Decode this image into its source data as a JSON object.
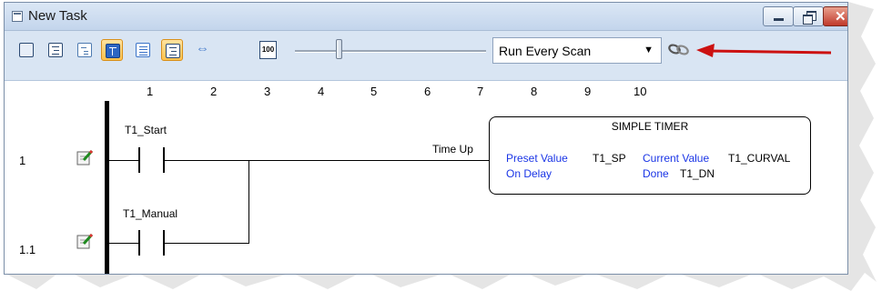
{
  "window": {
    "title": "New Task"
  },
  "toolbar": {
    "buttons": [
      {
        "name": "view-ladder-button",
        "active": false
      },
      {
        "name": "view-list-button",
        "active": false
      },
      {
        "name": "view-tree-button",
        "active": false
      },
      {
        "name": "view-text-button",
        "active": true
      },
      {
        "name": "view-detail-button",
        "active": false
      },
      {
        "name": "view-structure-button",
        "active": true
      }
    ],
    "zoom_label": "100",
    "run_mode": "Run Every Scan"
  },
  "ruler": {
    "columns": [
      "1",
      "2",
      "3",
      "4",
      "5",
      "6",
      "7",
      "8",
      "9",
      "10"
    ]
  },
  "rungs": [
    {
      "number": "1",
      "contact_tag": "T1_Start"
    },
    {
      "number": "1.1",
      "contact_tag": "T1_Manual"
    }
  ],
  "output_label": "Time Up",
  "timer": {
    "title": "SIMPLE TIMER",
    "preset_label": "Preset Value",
    "preset_value": "T1_SP",
    "mode": "On Delay",
    "current_label": "Current Value",
    "current_value": "T1_CURVAL",
    "done_label": "Done",
    "done_value": "T1_DN"
  },
  "colors": {
    "annotation_arrow": "#cc1111",
    "timer_label": "#1a35e6"
  }
}
